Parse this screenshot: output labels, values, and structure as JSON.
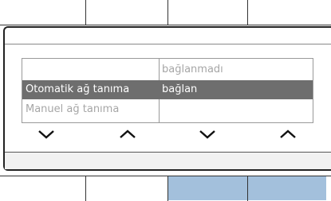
{
  "list": {
    "rows": [
      {
        "left": "",
        "right": "bağlanmadı"
      },
      {
        "left": "Otomatik ağ tanıma",
        "right": "bağlan"
      },
      {
        "left": "Manuel ağ tanıma",
        "right": ""
      }
    ]
  },
  "nav": {
    "icons": [
      "chevron-down-icon",
      "chevron-up-icon",
      "chevron-down-icon",
      "chevron-up-icon"
    ]
  },
  "colors": {
    "selected_row": "#6e6e6e",
    "softkey_active": "#a3c0dc",
    "dim_text": "#a6a6a6"
  }
}
